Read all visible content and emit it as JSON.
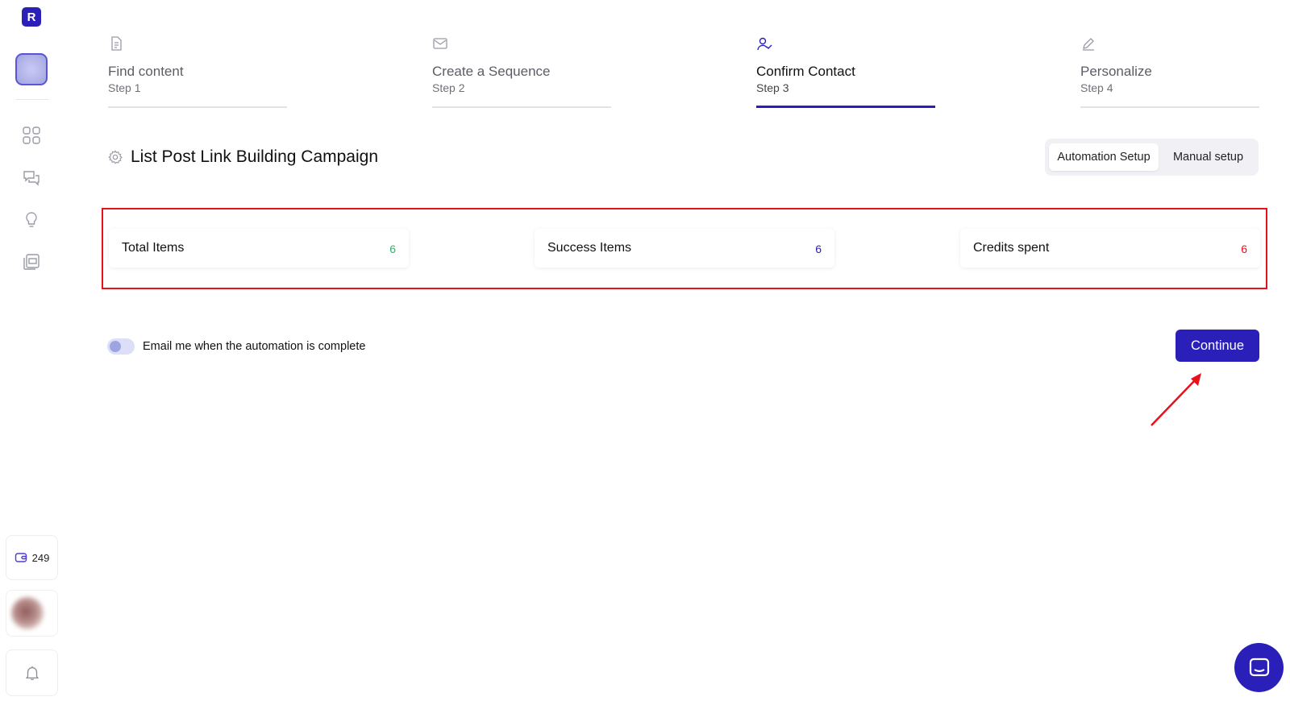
{
  "sidebar": {
    "logo_letter": "R",
    "nav_icons": [
      "grid-icon",
      "chat-icon",
      "lightbulb-icon",
      "document-stack-icon"
    ],
    "credits_value": "249",
    "credits_icon": "wallet-icon",
    "bell_icon": "bell-icon"
  },
  "steps": [
    {
      "title": "Find content",
      "sub": "Step 1",
      "icon": "document-icon",
      "active": false
    },
    {
      "title": "Create a Sequence",
      "sub": "Step 2",
      "icon": "envelope-icon",
      "active": false
    },
    {
      "title": "Confirm Contact",
      "sub": "Step 3",
      "icon": "user-check-icon",
      "active": true
    },
    {
      "title": "Personalize",
      "sub": "Step 4",
      "icon": "pen-icon",
      "active": false
    }
  ],
  "campaign": {
    "title": "List Post Link Building Campaign",
    "icon": "gear-icon"
  },
  "setup_toggle": {
    "automation_label": "Automation Setup",
    "manual_label": "Manual setup",
    "selected": "Automation Setup"
  },
  "stats": [
    {
      "label": "Total Items",
      "value": "6",
      "color": "#2cb46b"
    },
    {
      "label": "Success Items",
      "value": "6",
      "color": "#2a1fb8"
    },
    {
      "label": "Credits spent",
      "value": "6",
      "color": "#e8101b"
    }
  ],
  "email_toggle": {
    "label": "Email me when the automation is complete",
    "enabled": false
  },
  "continue_label": "Continue",
  "colors": {
    "accent": "#2a1fb8",
    "highlight": "#e8101b"
  }
}
